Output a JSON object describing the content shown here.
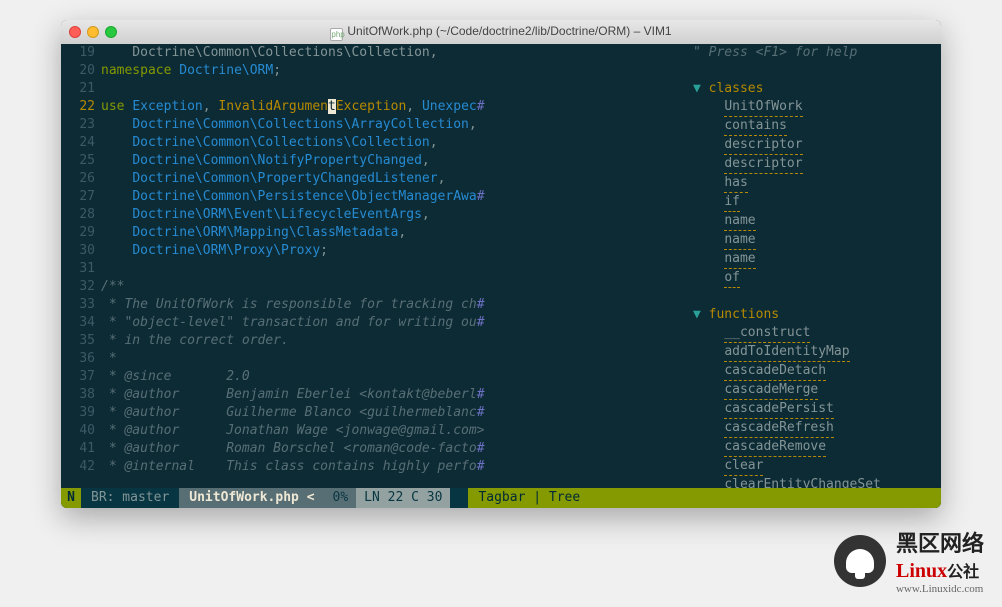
{
  "window": {
    "title": "UnitOfWork.php (~/Code/doctrine2/lib/Doctrine/ORM) – VIM1"
  },
  "gutter": {
    "start": 19,
    "end": 42,
    "current": 22
  },
  "code_lines": [
    {
      "n": 19,
      "html": "<span class='sep'>    Doctrine\\Common\\Collections\\Collection,</span>"
    },
    {
      "n": 20,
      "html": "<span class='kw2'>namespace</span> <span class='ns'>Doctrine\\ORM</span><span class='sep'>;</span>"
    },
    {
      "n": 21,
      "html": ""
    },
    {
      "n": 22,
      "html": "<span class='kw2'>use</span> <span class='cls'>Exception</span><span class='sep'>,</span> <span class='cls2'>InvalidArgumen</span><span class='hl'>t</span><span class='cls2'>Exception</span><span class='sep'>,</span> <span class='cls'>Unexpec</span><span class='hash'>#</span>"
    },
    {
      "n": 23,
      "html": "    <span class='ns'>Doctrine\\Common\\Collections\\ArrayCollection</span><span class='sep'>,</span>"
    },
    {
      "n": 24,
      "html": "    <span class='ns'>Doctrine\\Common\\Collections\\Collection</span><span class='sep'>,</span>"
    },
    {
      "n": 25,
      "html": "    <span class='ns'>Doctrine\\Common\\NotifyPropertyChanged</span><span class='sep'>,</span>"
    },
    {
      "n": 26,
      "html": "    <span class='ns'>Doctrine\\Common\\PropertyChangedListener</span><span class='sep'>,</span>"
    },
    {
      "n": 27,
      "html": "    <span class='ns'>Doctrine\\Common\\Persistence\\ObjectManagerAwa</span><span class='hash'>#</span>"
    },
    {
      "n": 28,
      "html": "    <span class='ns'>Doctrine\\ORM\\Event\\LifecycleEventArgs</span><span class='sep'>,</span>"
    },
    {
      "n": 29,
      "html": "    <span class='ns'>Doctrine\\ORM\\Mapping\\ClassMetadata</span><span class='sep'>,</span>"
    },
    {
      "n": 30,
      "html": "    <span class='ns'>Doctrine\\ORM\\Proxy\\Proxy</span><span class='sep'>;</span>"
    },
    {
      "n": 31,
      "html": ""
    },
    {
      "n": 32,
      "html": "<span class='cmt'>/**</span>"
    },
    {
      "n": 33,
      "html": "<span class='cmt'> * The UnitOfWork is responsible for tracking ch</span><span class='hash'>#</span>"
    },
    {
      "n": 34,
      "html": "<span class='cmt'> * \"object-level\" transaction and for writing ou</span><span class='hash'>#</span>"
    },
    {
      "n": 35,
      "html": "<span class='cmt'> * in the correct order.</span>"
    },
    {
      "n": 36,
      "html": "<span class='cmt'> *</span>"
    },
    {
      "n": 37,
      "html": "<span class='cmt'> * @since       2.0</span>"
    },
    {
      "n": 38,
      "html": "<span class='cmt'> * @author      Benjamin Eberlei &lt;kontakt@beberl</span><span class='hash'>#</span>"
    },
    {
      "n": 39,
      "html": "<span class='cmt'> * @author      Guilherme Blanco &lt;guilhermeblanc</span><span class='hash'>#</span>"
    },
    {
      "n": 40,
      "html": "<span class='cmt'> * @author      Jonathan Wage &lt;jonwage@gmail.com&gt;</span>"
    },
    {
      "n": 41,
      "html": "<span class='cmt'> * @author      Roman Borschel &lt;roman@code-facto</span><span class='hash'>#</span>"
    },
    {
      "n": 42,
      "html": "<span class='cmt'> * @internal    This class contains highly perfo</span><span class='hash'>#</span>"
    }
  ],
  "tagbar": {
    "help": "\" Press <F1> for help",
    "sections": [
      {
        "name": "classes",
        "items": [
          "UnitOfWork",
          "contains",
          "descriptor",
          "descriptor",
          "has",
          "if",
          "name",
          "name",
          "name",
          "of"
        ]
      },
      {
        "name": "functions",
        "items": [
          "__construct",
          "addToIdentityMap",
          "cascadeDetach",
          "cascadeMerge",
          "cascadePersist",
          "cascadeRefresh",
          "cascadeRemove",
          "clear",
          "clearEntityChangeSet"
        ]
      }
    ]
  },
  "statusbar": {
    "mode": "N",
    "branch": "BR: master",
    "file": "UnitOfWork.php",
    "mod": "<",
    "pct": "0%",
    "ln_label": "LN",
    "ln": "22",
    "c_label": "C",
    "col": "30",
    "right": "Tagbar | Tree"
  },
  "watermark": {
    "cn": "黑区网络",
    "brand": "Linux",
    "suffix": "公社",
    "url": "www.Linuxidc.com"
  }
}
